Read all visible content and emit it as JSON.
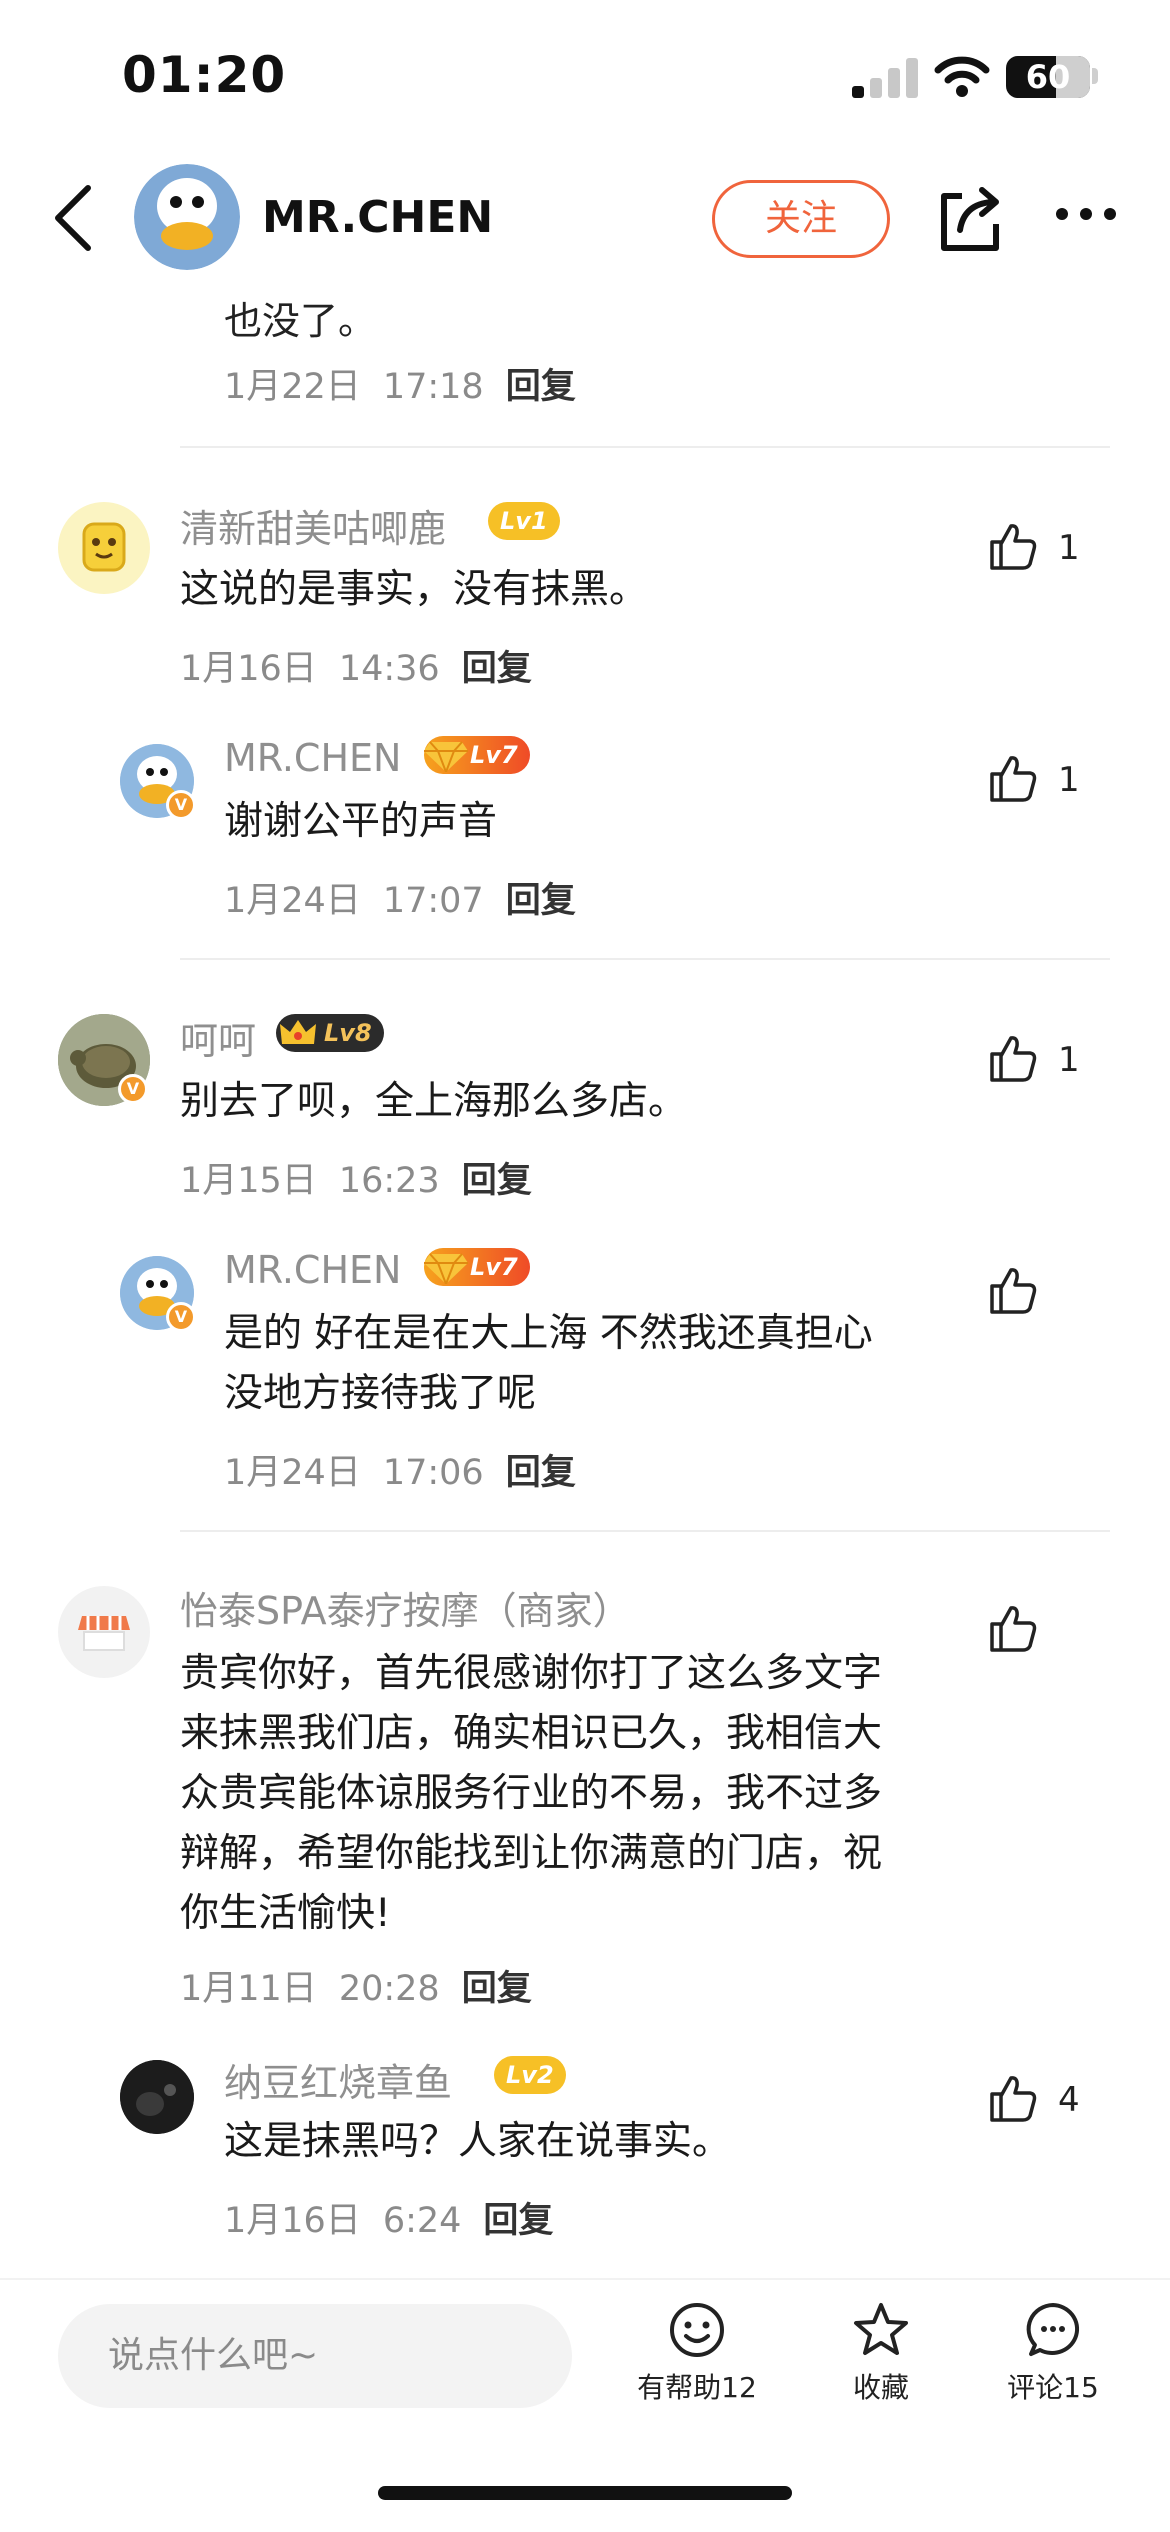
{
  "status_bar": {
    "time": "01:20",
    "battery": "60",
    "battery_level": 0.6
  },
  "header": {
    "username": "MR.CHEN",
    "follow_label": "关注"
  },
  "thread": {
    "partial": {
      "text": "也没了。",
      "date": "1月22日",
      "time": "17:18",
      "reply": "回复"
    },
    "comments": [
      {
        "name": "清新甜美咕唧鹿",
        "level": "Lv1",
        "text": "这说的是事实，没有抹黑。",
        "date": "1月16日",
        "time": "14:36",
        "reply": "回复",
        "likes": "1",
        "reply_item": {
          "name": "MR.CHEN",
          "level": "Lv7",
          "text": "谢谢公平的声音",
          "date": "1月24日",
          "time": "17:07",
          "reply": "回复",
          "likes": "1"
        }
      },
      {
        "name": "呵呵",
        "level": "Lv8",
        "text": "别去了呗，全上海那么多店。",
        "date": "1月15日",
        "time": "16:23",
        "reply": "回复",
        "likes": "1",
        "reply_item": {
          "name": "MR.CHEN",
          "level": "Lv7",
          "text_line1": "是的 好在是在大上海 不然我还真担心",
          "text_line2": "没地方接待我了呢",
          "date": "1月24日",
          "time": "17:06",
          "reply": "回复"
        }
      },
      {
        "name": "怡泰SPA泰疗按摩（商家）",
        "text_lines": [
          "贵宾你好，首先很感谢你打了这么多文字",
          "来抹黑我们店，确实相识已久，我相信大",
          "众贵宾能体谅服务行业的不易，我不过多",
          "辩解，希望你能找到让你满意的门店，祝",
          "你生活愉快!"
        ],
        "date": "1月11日",
        "time": "20:28",
        "reply": "回复",
        "reply_item": {
          "name": "纳豆红烧章鱼",
          "level": "Lv2",
          "text": "这是抹黑吗？人家在说事实。",
          "date": "1月16日",
          "time": "6:24",
          "reply": "回复",
          "likes": "4"
        }
      }
    ]
  },
  "bottom_bar": {
    "input_placeholder": "说点什么吧~",
    "helpful_label": "有帮助12",
    "favorite_label": "收藏",
    "comments_label": "评论15"
  },
  "colors": {
    "accent": "#f0643c",
    "level_yellow": "#f6c026",
    "level_orange": "#ef4b27"
  }
}
